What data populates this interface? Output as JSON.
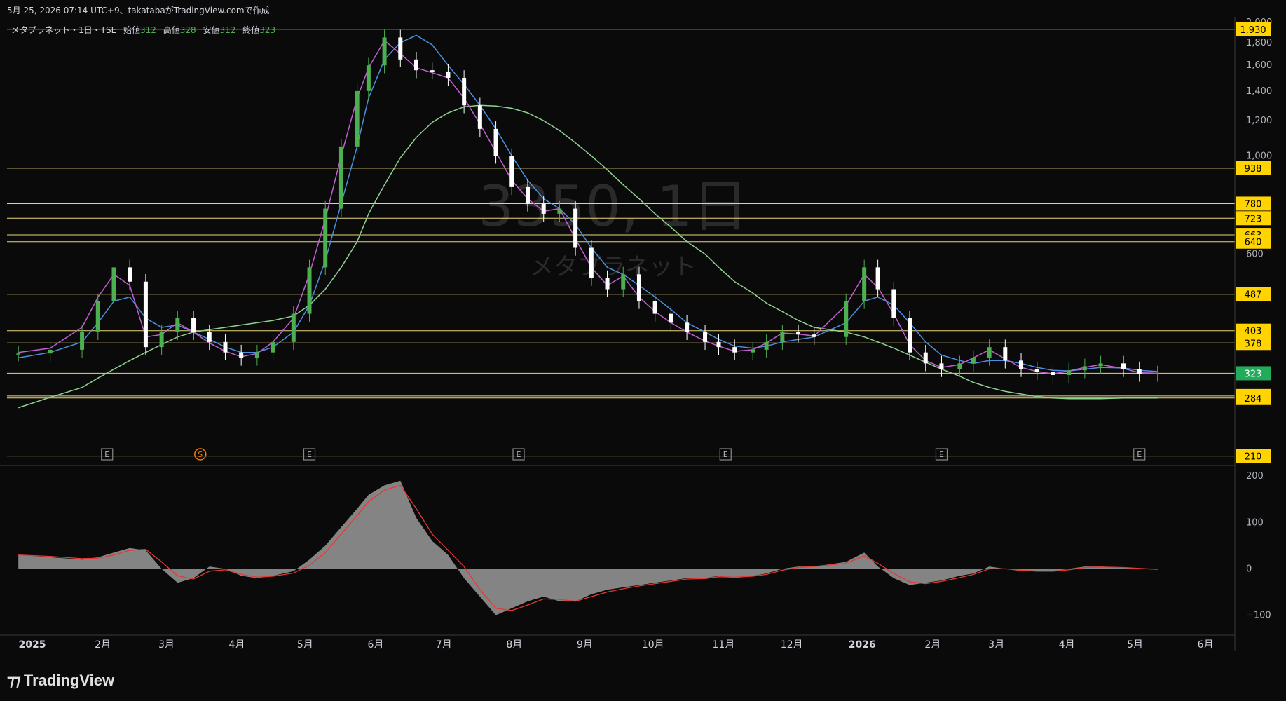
{
  "header": {
    "caption": "5月 25, 2026 07:14 UTC+9、takatabaがTradingView.comで作成"
  },
  "legend": {
    "symbol": "メタプラネット・1日・TSE",
    "open_label": "始値",
    "open": "312",
    "high_label": "高値",
    "high": "328",
    "low_label": "安値",
    "low": "312",
    "close_label": "終値",
    "close": "323"
  },
  "watermark": {
    "line1": "3350, 1日",
    "line2": "メタプラネット"
  },
  "footer": {
    "brand": "TradingView"
  },
  "colors": {
    "background": "#0a0a0a",
    "up": "#4caf50",
    "down": "#ffffff",
    "ma_short": "#c060d0",
    "ma_mid": "#4a90e2",
    "ma_long": "#8fd18f",
    "horizontal_line": "#e8d67a",
    "price_label_bg": "#ffd400",
    "current_price_bg": "#22ab5a",
    "macd_fill": "#9a9a9a",
    "signal": "#e53935"
  },
  "chart_data": [
    {
      "type": "line",
      "name_ref": "price",
      "y_scale": "log",
      "ylim": [
        200,
        2000
      ],
      "y_ticks": [
        "2,000",
        "1,800",
        "1,600",
        "1,400",
        "1,200",
        "1,000",
        "600"
      ],
      "x_ticks": [
        "2025",
        "2月",
        "3月",
        "4月",
        "5月",
        "6月",
        "7月",
        "8月",
        "9月",
        "10月",
        "11月",
        "12月",
        "2026",
        "2月",
        "3月",
        "4月",
        "5月",
        "6月"
      ],
      "horizontal_levels": [
        1930,
        938,
        780,
        723,
        663,
        640,
        487,
        403,
        378,
        323,
        287,
        284,
        210
      ],
      "current_price": 323,
      "event_markers": [
        {
          "x": "2025-02-14",
          "label": "E"
        },
        {
          "x": "2025-03-27",
          "label": "S"
        },
        {
          "x": "2025-05-14",
          "label": "E"
        },
        {
          "x": "2025-08-14",
          "label": "E"
        },
        {
          "x": "2025-11-13",
          "label": "E"
        },
        {
          "x": "2026-02-16",
          "label": "E"
        },
        {
          "x": "2026-05-14",
          "label": "E"
        }
      ],
      "close_series": {
        "x": [
          "2025-01-06",
          "2025-01-20",
          "2025-02-03",
          "2025-02-10",
          "2025-02-17",
          "2025-02-24",
          "2025-03-03",
          "2025-03-10",
          "2025-03-17",
          "2025-03-24",
          "2025-03-31",
          "2025-04-07",
          "2025-04-14",
          "2025-04-21",
          "2025-04-28",
          "2025-05-07",
          "2025-05-14",
          "2025-05-21",
          "2025-05-28",
          "2025-06-04",
          "2025-06-09",
          "2025-06-16",
          "2025-06-23",
          "2025-06-30",
          "2025-07-07",
          "2025-07-14",
          "2025-07-21",
          "2025-07-28",
          "2025-08-04",
          "2025-08-11",
          "2025-08-18",
          "2025-08-25",
          "2025-09-01",
          "2025-09-08",
          "2025-09-15",
          "2025-09-22",
          "2025-09-29",
          "2025-10-06",
          "2025-10-13",
          "2025-10-20",
          "2025-10-27",
          "2025-11-04",
          "2025-11-10",
          "2025-11-17",
          "2025-11-25",
          "2025-12-01",
          "2025-12-08",
          "2025-12-15",
          "2025-12-22",
          "2026-01-05",
          "2026-01-13",
          "2026-01-19",
          "2026-01-26",
          "2026-02-02",
          "2026-02-09",
          "2026-02-16",
          "2026-02-24",
          "2026-03-02",
          "2026-03-09",
          "2026-03-16",
          "2026-03-23",
          "2026-03-30",
          "2026-04-06",
          "2026-04-13",
          "2026-04-20",
          "2026-04-27",
          "2026-05-07",
          "2026-05-14",
          "2026-05-22"
        ],
        "values": [
          358,
          365,
          400,
          470,
          560,
          520,
          370,
          400,
          430,
          400,
          380,
          360,
          350,
          360,
          380,
          440,
          560,
          760,
          1050,
          1400,
          1600,
          1850,
          1650,
          1560,
          1550,
          1500,
          1300,
          1150,
          1000,
          850,
          780,
          740,
          760,
          620,
          530,
          500,
          540,
          470,
          440,
          420,
          400,
          380,
          370,
          360,
          365,
          380,
          400,
          395,
          390,
          470,
          560,
          500,
          430,
          360,
          340,
          330,
          340,
          350,
          370,
          345,
          330,
          325,
          320,
          328,
          335,
          340,
          330,
          322,
          323
        ]
      },
      "ma_short": [
        360,
        368,
        410,
        480,
        540,
        510,
        390,
        395,
        420,
        400,
        378,
        362,
        352,
        358,
        380,
        430,
        540,
        720,
        1000,
        1350,
        1580,
        1820,
        1700,
        1580,
        1540,
        1500,
        1350,
        1180,
        1020,
        880,
        800,
        750,
        760,
        650,
        560,
        510,
        535,
        480,
        445,
        420,
        400,
        382,
        372,
        362,
        365,
        378,
        398,
        396,
        392,
        460,
        540,
        505,
        440,
        375,
        345,
        333,
        338,
        350,
        365,
        348,
        333,
        326,
        322,
        327,
        333,
        338,
        331,
        324,
        323
      ],
      "ma_mid": [
        350,
        360,
        380,
        420,
        470,
        480,
        430,
        410,
        415,
        400,
        385,
        370,
        360,
        360,
        370,
        400,
        460,
        580,
        780,
        1050,
        1350,
        1650,
        1800,
        1870,
        1780,
        1600,
        1450,
        1300,
        1150,
        1000,
        880,
        800,
        760,
        700,
        620,
        560,
        540,
        510,
        480,
        450,
        420,
        400,
        385,
        372,
        368,
        372,
        380,
        385,
        390,
        420,
        470,
        480,
        460,
        420,
        380,
        355,
        345,
        340,
        345,
        345,
        340,
        333,
        328,
        327,
        330,
        333,
        332,
        328,
        326
      ],
      "ma_long": [
        270,
        285,
        300,
        315,
        330,
        345,
        360,
        375,
        390,
        400,
        405,
        410,
        415,
        420,
        425,
        435,
        460,
        500,
        560,
        640,
        740,
        860,
        990,
        1100,
        1190,
        1250,
        1290,
        1300,
        1295,
        1280,
        1250,
        1200,
        1140,
        1070,
        1000,
        930,
        860,
        800,
        740,
        690,
        640,
        600,
        560,
        520,
        490,
        465,
        445,
        425,
        410,
        400,
        390,
        380,
        368,
        355,
        342,
        330,
        318,
        308,
        300,
        294,
        290,
        286,
        284,
        283,
        283,
        283,
        284,
        284,
        284
      ]
    },
    {
      "type": "area",
      "name_ref": "oscillator",
      "ylim": [
        -140,
        220
      ],
      "y_ticks": [
        "200",
        "100",
        "0",
        "−100"
      ],
      "x": [
        "2025-01-06",
        "2025-01-20",
        "2025-02-03",
        "2025-02-10",
        "2025-02-17",
        "2025-02-24",
        "2025-03-03",
        "2025-03-10",
        "2025-03-17",
        "2025-03-24",
        "2025-03-31",
        "2025-04-07",
        "2025-04-14",
        "2025-04-21",
        "2025-04-28",
        "2025-05-07",
        "2025-05-14",
        "2025-05-21",
        "2025-05-28",
        "2025-06-04",
        "2025-06-09",
        "2025-06-16",
        "2025-06-23",
        "2025-06-30",
        "2025-07-07",
        "2025-07-14",
        "2025-07-21",
        "2025-07-28",
        "2025-08-04",
        "2025-08-11",
        "2025-08-18",
        "2025-08-25",
        "2025-09-01",
        "2025-09-08",
        "2025-09-15",
        "2025-09-22",
        "2025-09-29",
        "2025-10-06",
        "2025-10-13",
        "2025-10-20",
        "2025-10-27",
        "2025-11-04",
        "2025-11-10",
        "2025-11-17",
        "2025-11-25",
        "2025-12-01",
        "2025-12-08",
        "2025-12-15",
        "2025-12-22",
        "2026-01-05",
        "2026-01-13",
        "2026-01-19",
        "2026-01-26",
        "2026-02-02",
        "2026-02-09",
        "2026-02-16",
        "2026-02-24",
        "2026-03-02",
        "2026-03-09",
        "2026-03-16",
        "2026-03-23",
        "2026-03-30",
        "2026-04-06",
        "2026-04-13",
        "2026-04-20",
        "2026-04-27",
        "2026-05-07",
        "2026-05-14",
        "2026-05-22"
      ],
      "macd": [
        30,
        25,
        20,
        25,
        35,
        45,
        40,
        0,
        -30,
        -20,
        5,
        0,
        -15,
        -20,
        -15,
        -5,
        20,
        50,
        90,
        130,
        160,
        180,
        190,
        110,
        60,
        30,
        -20,
        -60,
        -100,
        -85,
        -70,
        -60,
        -70,
        -70,
        -55,
        -45,
        -40,
        -35,
        -30,
        -25,
        -20,
        -20,
        -15,
        -20,
        -15,
        -10,
        0,
        5,
        5,
        15,
        35,
        5,
        -20,
        -35,
        -30,
        -25,
        -15,
        -10,
        5,
        0,
        -5,
        -5,
        -5,
        0,
        5,
        5,
        3,
        0,
        -2
      ],
      "signal": [
        30,
        27,
        22,
        23,
        30,
        40,
        42,
        15,
        -15,
        -22,
        -5,
        -2,
        -12,
        -18,
        -16,
        -9,
        8,
        35,
        75,
        115,
        145,
        170,
        180,
        130,
        75,
        40,
        5,
        -45,
        -85,
        -90,
        -78,
        -65,
        -66,
        -70,
        -60,
        -50,
        -43,
        -37,
        -32,
        -27,
        -22,
        -21,
        -17,
        -18,
        -16,
        -12,
        -3,
        3,
        5,
        12,
        28,
        12,
        -10,
        -28,
        -32,
        -27,
        -19,
        -12,
        0,
        0,
        -3,
        -5,
        -5,
        -2,
        3,
        4,
        3,
        1,
        -1
      ]
    }
  ]
}
